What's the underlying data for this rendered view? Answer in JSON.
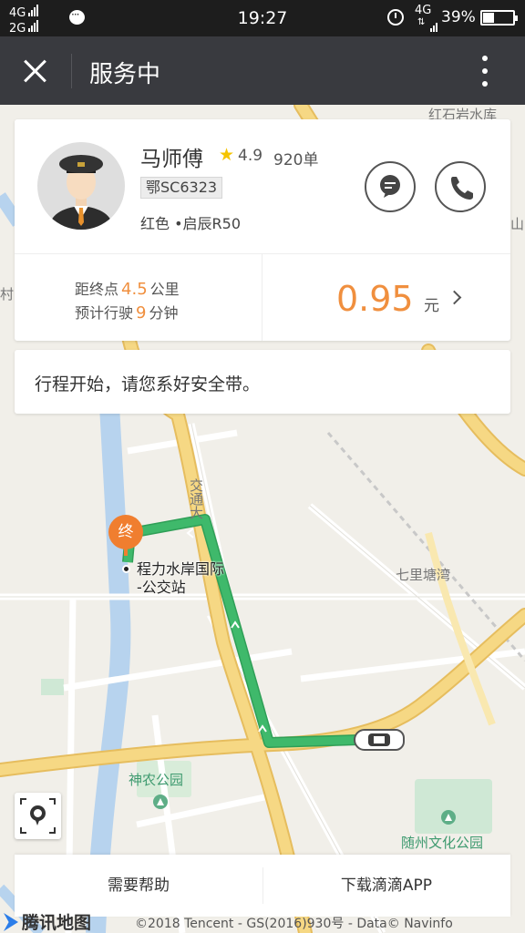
{
  "status_bar": {
    "network1": "4G",
    "network2": "2G",
    "time": "19:27",
    "network_right": "4G",
    "battery": "39%",
    "battery_level": 0.39
  },
  "nav": {
    "title": "服务中"
  },
  "driver": {
    "name": "马师傅",
    "rating": "4.9",
    "orders": "920单",
    "plate": "鄂SC6323",
    "car": "红色 •启辰R50"
  },
  "trip": {
    "dist_prefix": "距终点",
    "dist_value": "4.5",
    "dist_unit": "公里",
    "eta_prefix": "预计行驶",
    "eta_value": "9",
    "eta_unit": "分钟",
    "fare": "0.95",
    "fare_unit": "元"
  },
  "notice": "行程开始，请您系好安全带。",
  "map": {
    "labels": {
      "reservoir": "红石岩水库",
      "village": "村",
      "mountain": "山",
      "road": "交通大",
      "qili": "七里塘湾",
      "shennong": "神农公园",
      "suizhou": "随州文化公园"
    },
    "destination_marker": "终",
    "stop_line1": "程力水岸国际",
    "stop_line2": "-公交站",
    "logo": "腾讯地图",
    "copyright": "©2018 Tencent - GS(2016)930号 - Data© Navinfo"
  },
  "bottom": {
    "help": "需要帮助",
    "download": "下载滴滴APP"
  },
  "colors": {
    "route": "#3fb96b",
    "accent": "#f08f3e",
    "road_major": "#f3d27a",
    "navbar": "#393a3f"
  }
}
